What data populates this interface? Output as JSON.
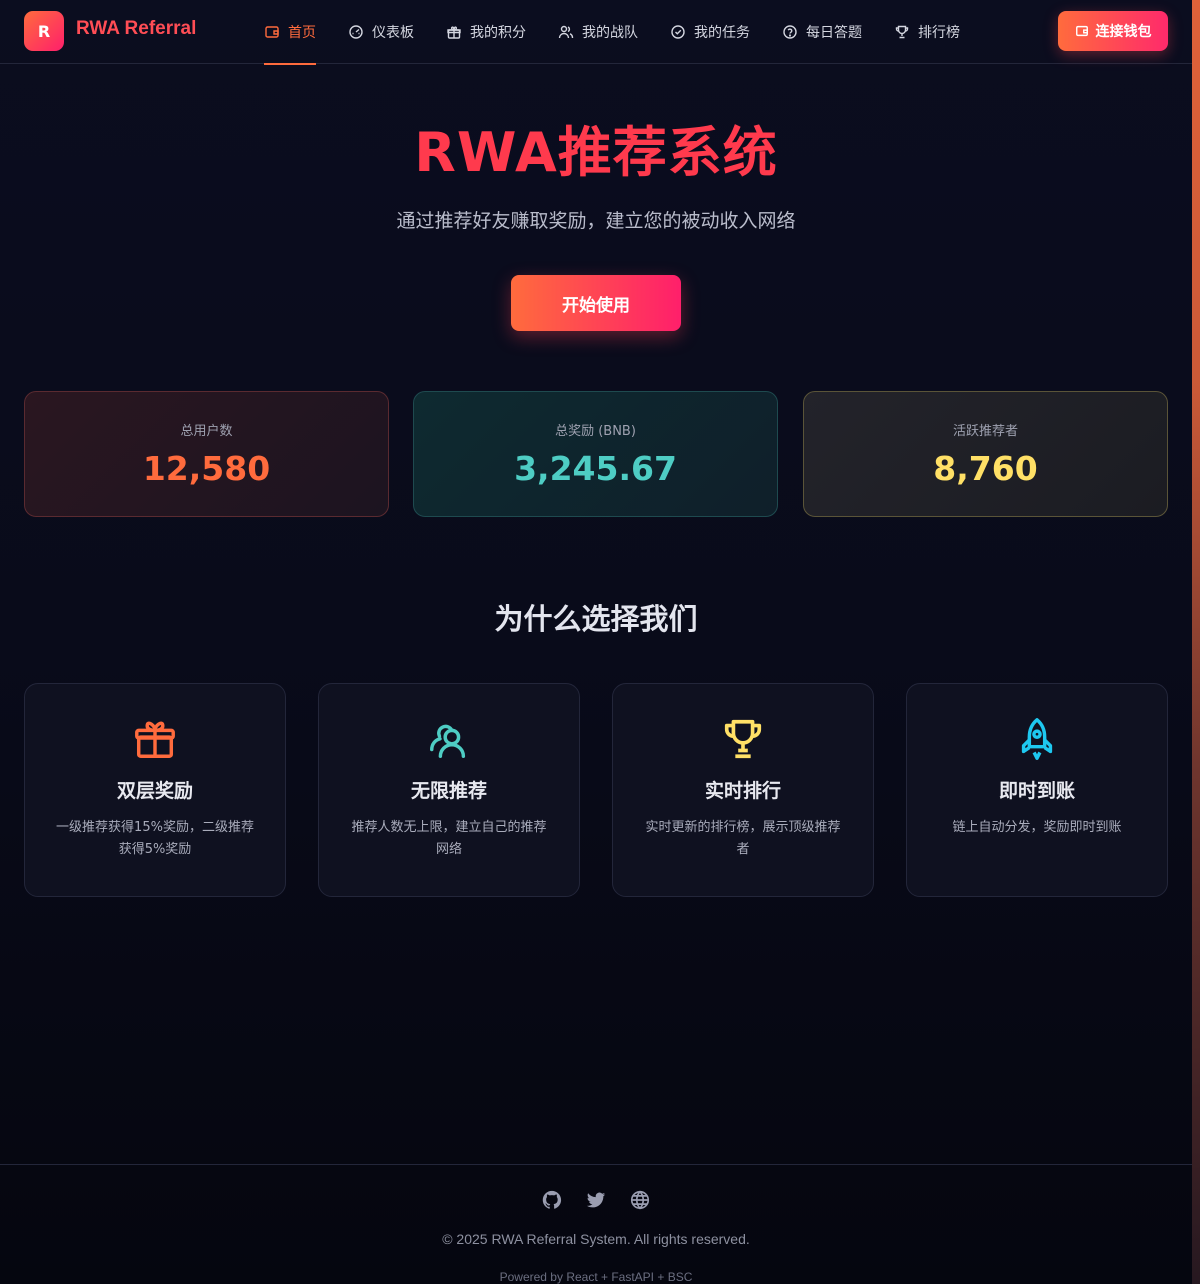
{
  "brand": {
    "logo_letter": "R",
    "name": "RWA Referral"
  },
  "nav": {
    "items": [
      {
        "label": "首页",
        "icon": "wallet-icon",
        "active": true
      },
      {
        "label": "仪表板",
        "icon": "gauge-icon"
      },
      {
        "label": "我的积分",
        "icon": "gift-icon"
      },
      {
        "label": "我的战队",
        "icon": "users-icon"
      },
      {
        "label": "我的任务",
        "icon": "check-circle-icon"
      },
      {
        "label": "每日答题",
        "icon": "question-circle-icon"
      },
      {
        "label": "排行榜",
        "icon": "trophy-icon"
      }
    ],
    "connect_label": "连接钱包"
  },
  "hero": {
    "title": "RWA推荐系统",
    "subtitle": "通过推荐好友赚取奖励，建立您的被动收入网络",
    "cta": "开始使用"
  },
  "stats": [
    {
      "label": "总用户数",
      "value": "12,580",
      "color": "#ff6b3d"
    },
    {
      "label": "总奖励 (BNB)",
      "value": "3,245.67",
      "color": "#4ecdc4"
    },
    {
      "label": "活跃推荐者",
      "value": "8,760",
      "color": "#ffe066"
    }
  ],
  "why": {
    "title": "为什么选择我们",
    "features": [
      {
        "icon": "gift-icon",
        "title": "双层奖励",
        "desc": "一级推荐获得15%奖励，二级推荐获得5%奖励",
        "color": "#ff6b3d"
      },
      {
        "icon": "users-icon",
        "title": "无限推荐",
        "desc": "推荐人数无上限，建立自己的推荐网络",
        "color": "#4ecdc4"
      },
      {
        "icon": "trophy-icon",
        "title": "实时排行",
        "desc": "实时更新的排行榜，展示顶级推荐者",
        "color": "#ffe066"
      },
      {
        "icon": "rocket-icon",
        "title": "即时到账",
        "desc": "链上自动分发，奖励即时到账",
        "color": "#1ec8f0"
      }
    ]
  },
  "footer": {
    "social": [
      "github-icon",
      "twitter-icon",
      "globe-icon"
    ],
    "copyright": "© 2025 RWA Referral System. All rights reserved.",
    "powered": "Powered by React + FastAPI + BSC"
  }
}
